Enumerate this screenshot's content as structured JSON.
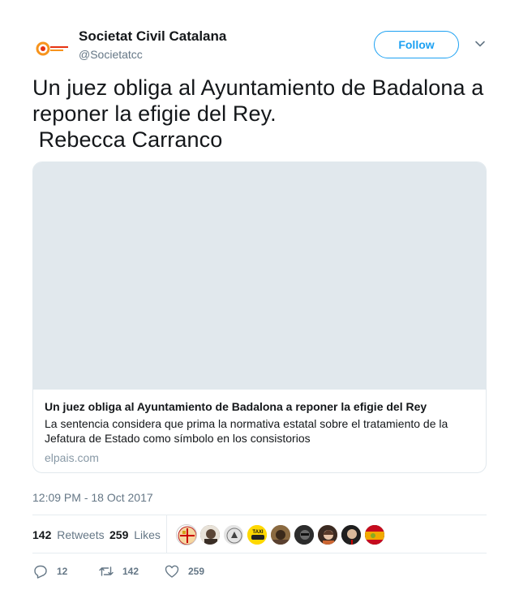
{
  "account": {
    "display_name": "Societat Civil Catalana",
    "screen_name": "@Societatcc",
    "follow_label": "Follow"
  },
  "tweet": {
    "text": "Un juez obliga al Ayuntamiento de Badalona a reponer la efigie del Rey.\n Rebecca Carranco",
    "timestamp": "12:09 PM - 18 Oct 2017"
  },
  "card": {
    "title": "Un juez obliga al Ayuntamiento de Badalona a reponer la efigie del Rey",
    "description": "La sentencia considera que prima la normativa estatal sobre el tratamiento de la Jefatura de Estado como símbolo en los consistorios",
    "domain": "elpais.com"
  },
  "stats": {
    "retweets_count": "142",
    "retweets_label": "Retweets",
    "likes_count": "259",
    "likes_label": "Likes"
  },
  "actions": {
    "reply_count": "12",
    "retweet_count": "142",
    "like_count": "259"
  },
  "colors": {
    "accent": "#1da1f2",
    "text": "#14171a",
    "muted": "#657786",
    "border": "#e6ecf0",
    "card_image_bg": "#e1e8ed"
  },
  "icons": {
    "avatar": "societat-civil-catalana-logo",
    "caret": "chevron-down-icon",
    "reply": "reply-icon",
    "retweet": "retweet-icon",
    "like": "heart-icon"
  }
}
